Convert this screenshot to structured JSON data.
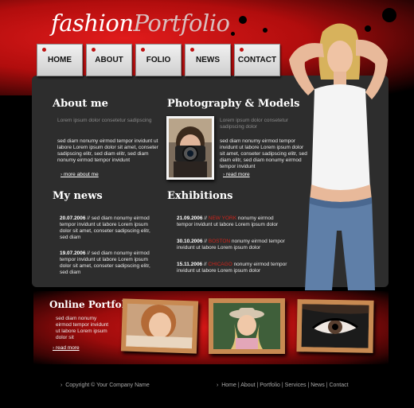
{
  "header": {
    "logo_part1": "fashion",
    "logo_part2": "Portfolio"
  },
  "nav": {
    "items": [
      "HOME",
      "ABOUT",
      "FOLIO",
      "NEWS",
      "CONTACT"
    ]
  },
  "about": {
    "title": "About me",
    "intro": "Lorem ipsum dolor consetetur sadipscing",
    "body": "sed diam nonumy eirmod tempor invidunt ut labore Lorem ipsum dolor sit amet, conseter sadipscing elitr, sed diam elitr, sed diam nonumy eirmod tempor invidunt",
    "more": "more about me"
  },
  "photography": {
    "title": "Photography & Models",
    "intro": "Lorem ipsum dolor consetetur sadipscing dolor",
    "body": "sed diam nonumy eirmod tempor invidunt ut labore Lorem ipsum dolor sit amet, conseter sadipscing elitr, sed diam elitr, sed diam nonumy eirmod tempor invidunt",
    "more": "read more"
  },
  "news": {
    "title": "My news",
    "items": [
      {
        "date": "20.07.2006",
        "sep": " // ",
        "text": "sed diam nonumy eirmod tempor invidunt ut labore Lorem ipsum dolor sit amet, conseter sadipscing elitr, sed diam"
      },
      {
        "date": "19.07.2006",
        "sep": " // ",
        "text": "sed diam nonumy eirmod tempor invidunt ut labore Lorem ipsum dolor sit amet, conseter sadipscing elitr, sed diam"
      }
    ]
  },
  "exhibitions": {
    "title": "Exhibitions",
    "items": [
      {
        "date": "21.09.2006",
        "sep": " // ",
        "city": "NEW YORK",
        "text": " nonumy eirmod tempor invidunt ut labore Lorem ipsum dolor"
      },
      {
        "date": "30.10.2006",
        "sep": " // ",
        "city": "BOSTON",
        "text": " nonumy eirmod tempor invidunt ut labore Lorem ipsum dolor"
      },
      {
        "date": "15.11.2006",
        "sep": " // ",
        "city": "CHICAGO",
        "text": " nonumy eirmod tempor invidunt ut labore Lorem ipsum dolor"
      }
    ]
  },
  "portfolio": {
    "title": "Online Portfolio",
    "body": "sed diam nonumy eirmod tempor invidunt ut labore Lorem ipsum dolor sit",
    "more": "read more"
  },
  "footer": {
    "copyright": "Copyright © Your Company Name",
    "links": [
      "Home",
      "About",
      "Portfolio",
      "Services",
      "News",
      "Contact"
    ],
    "sep": " | "
  },
  "colors": {
    "accent": "#d0251b",
    "panel": "#2d2d2d",
    "header_red": "#c41212"
  }
}
